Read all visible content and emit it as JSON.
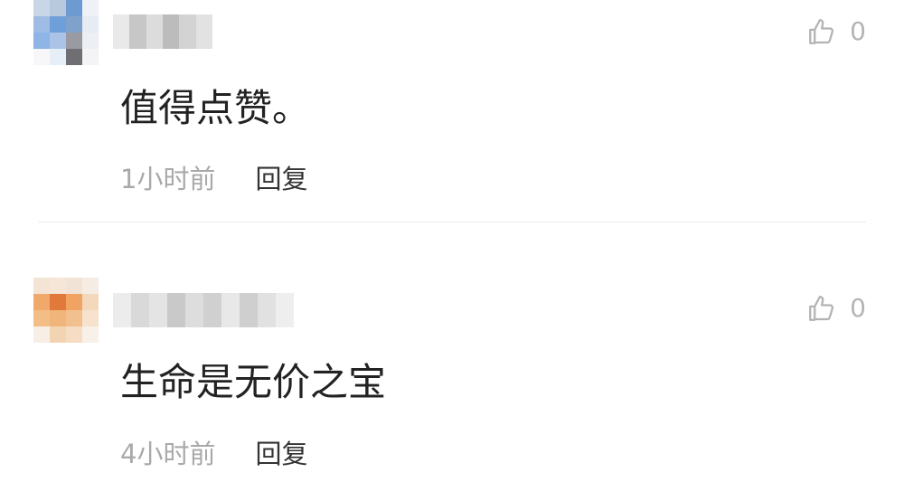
{
  "comments": [
    {
      "avatar_colors": [
        "#c9d6e6",
        "#b8c9de",
        "#6d9ad0",
        "#eef1f5",
        "#9fbde4",
        "#6f9fd8",
        "#7fa2cc",
        "#e7ecf2",
        "#8fb4e6",
        "#aac3e6",
        "#9a9aa3",
        "#eceff3",
        "#f7f7f9",
        "#e6eef8",
        "#6e6e73",
        "#f4f4f6"
      ],
      "username_colors": [
        "#e9e9e9",
        "#c7c7c7",
        "#dcdcdc",
        "#bcbcbc",
        "#d3d3d3",
        "#e2e2e2"
      ],
      "like_count": "0",
      "content": "值得点赞。",
      "time": "1小时前",
      "reply_label": "回复"
    },
    {
      "avatar_colors": [
        "#f3e4d6",
        "#f5e6d8",
        "#f1e3d5",
        "#f5ece3",
        "#f0a96a",
        "#e0793a",
        "#f0a362",
        "#f4d8bc",
        "#f3be86",
        "#f0b57a",
        "#f2c08f",
        "#f6e2cd",
        "#f7efe6",
        "#f2d4b2",
        "#f5dcc2",
        "#f8f1ea"
      ],
      "username_colors": [
        "#ececec",
        "#d9d9d9",
        "#e4e4e4",
        "#c9c9c9",
        "#dddddd",
        "#d0d0d0",
        "#e8e8e8",
        "#cfcfcf",
        "#e1e1e1",
        "#eeeeee"
      ],
      "like_count": "0",
      "content": "生命是无价之宝",
      "time": "4小时前",
      "reply_label": "回复"
    }
  ],
  "colors": {
    "text": "#222222",
    "muted": "#a9a9a9",
    "divider": "#ececec"
  },
  "icons": {
    "like": "thumbs-up-icon"
  }
}
